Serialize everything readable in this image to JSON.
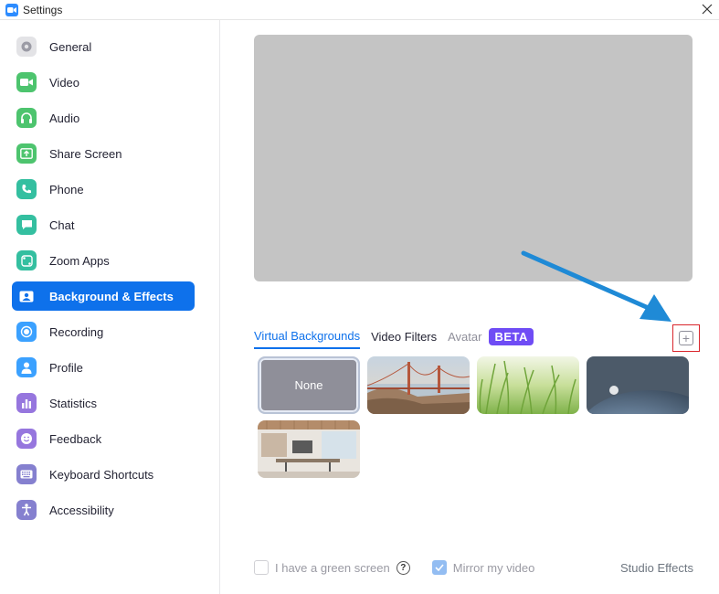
{
  "window": {
    "title": "Settings",
    "app_icon": "zoom-camera-icon",
    "close_icon": "close-icon"
  },
  "sidebar": {
    "items": [
      {
        "label": "General",
        "icon": "gear-icon",
        "color": "#8e8e99",
        "active": false
      },
      {
        "label": "Video",
        "icon": "video-camera-icon",
        "color": "#3fbf63",
        "active": false
      },
      {
        "label": "Audio",
        "icon": "headphones-icon",
        "color": "#3fbf63",
        "active": false
      },
      {
        "label": "Share Screen",
        "icon": "share-screen-icon",
        "color": "#3fbf63",
        "active": false
      },
      {
        "label": "Phone",
        "icon": "phone-icon",
        "color": "#2ab899",
        "active": false
      },
      {
        "label": "Chat",
        "icon": "chat-bubble-icon",
        "color": "#2ab899",
        "active": false
      },
      {
        "label": "Zoom Apps",
        "icon": "zoom-apps-icon",
        "color": "#2ab899",
        "active": false
      },
      {
        "label": "Background & Effects",
        "icon": "background-icon",
        "color": "#0e71eb",
        "active": true
      },
      {
        "label": "Recording",
        "icon": "record-icon",
        "color": "#2d9cff",
        "active": false
      },
      {
        "label": "Profile",
        "icon": "profile-icon",
        "color": "#2d9cff",
        "active": false
      },
      {
        "label": "Statistics",
        "icon": "statistics-icon",
        "color": "#8d6cd6",
        "active": false
      },
      {
        "label": "Feedback",
        "icon": "feedback-smile-icon",
        "color": "#8d6cd6",
        "active": false
      },
      {
        "label": "Keyboard Shortcuts",
        "icon": "keyboard-icon",
        "color": "#7b76c2",
        "active": false
      },
      {
        "label": "Accessibility",
        "icon": "accessibility-icon",
        "color": "#7b76c2",
        "active": false
      }
    ]
  },
  "main": {
    "tabs": {
      "virtual_backgrounds": "Virtual Backgrounds",
      "video_filters": "Video Filters",
      "avatar": "Avatar",
      "beta": "BETA"
    },
    "add_button_icon": "add-plus-icon",
    "thumbnails": {
      "none_label": "None",
      "items": [
        "none",
        "golden-gate-bridge",
        "grass",
        "earth-from-space",
        "office-interior"
      ]
    },
    "bottom": {
      "green_screen_label": "I have a green screen",
      "green_screen_checked": false,
      "help_icon_text": "?",
      "mirror_label": "Mirror my video",
      "mirror_checked": true,
      "studio_effects": "Studio Effects"
    }
  },
  "colors": {
    "accent": "#0e71eb",
    "beta_badge": "#6f4cf5",
    "add_highlight": "#d9262c",
    "annotation_arrow": "#1f8ad6"
  }
}
